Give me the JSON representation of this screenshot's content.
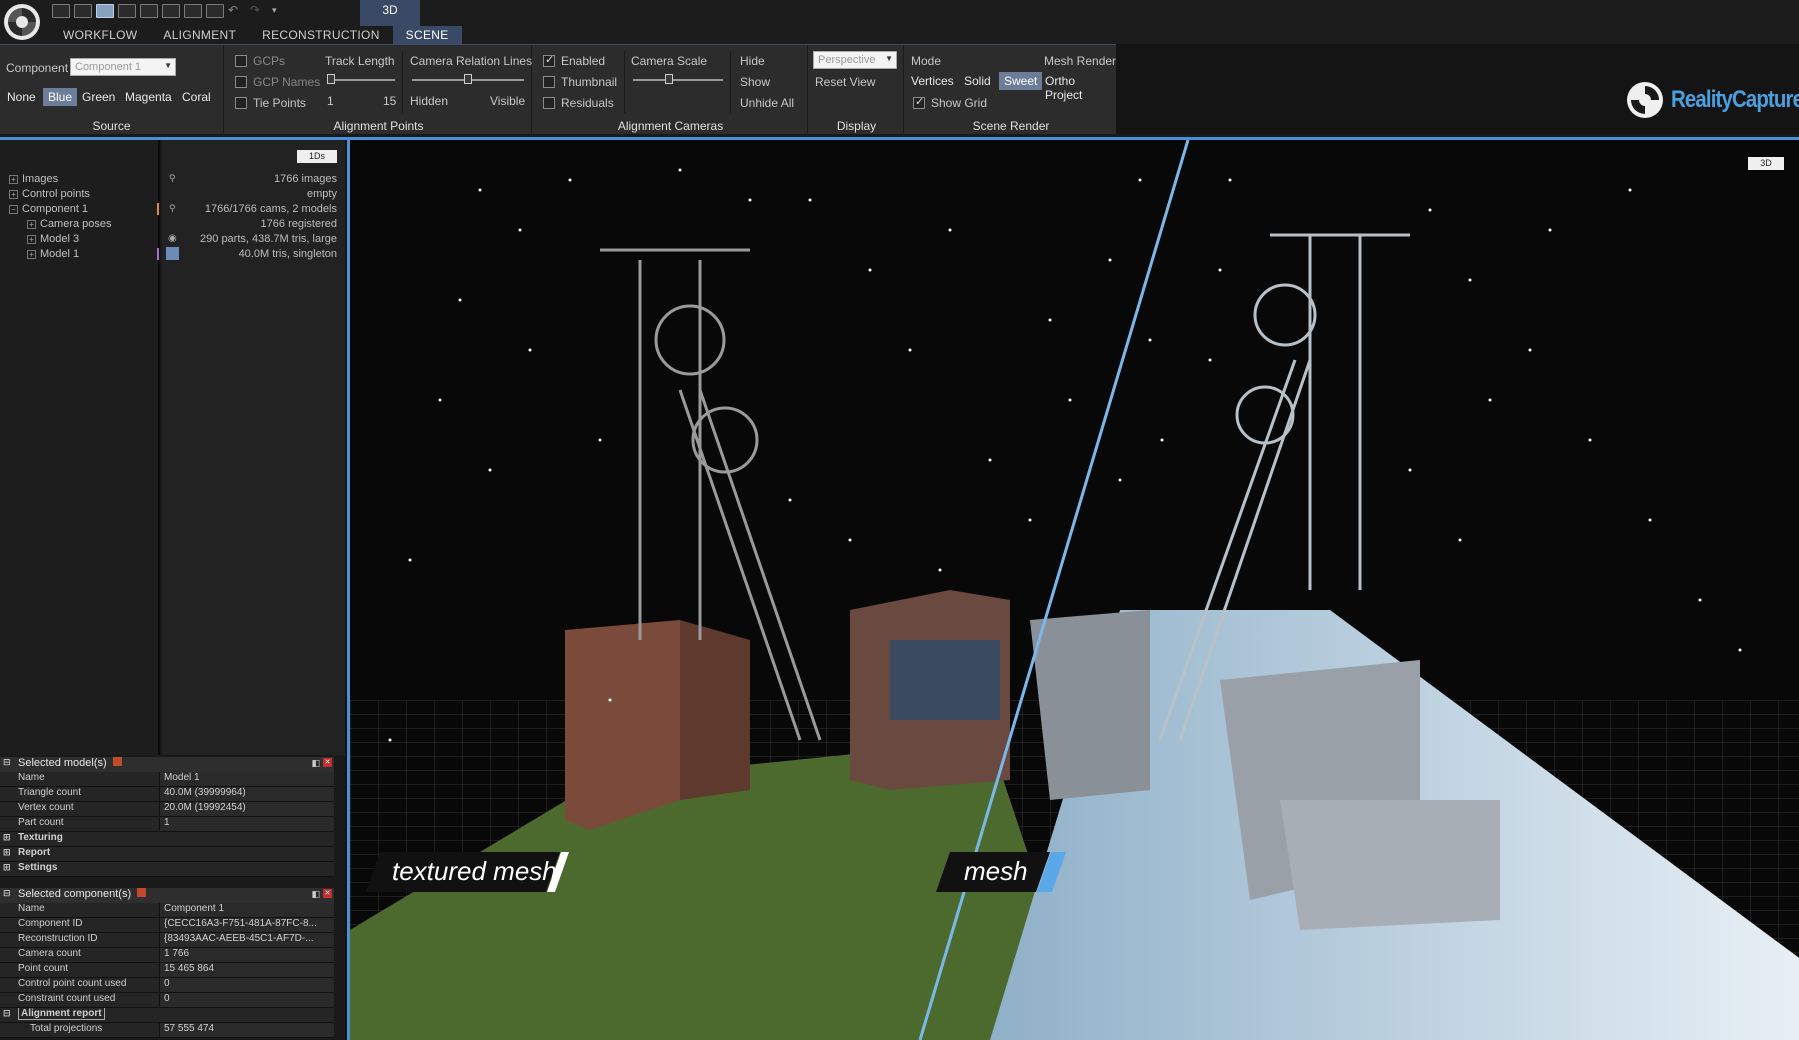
{
  "top_tabs": [
    "WORKFLOW",
    "ALIGNMENT",
    "RECONSTRUCTION",
    "SCENE"
  ],
  "active_tab": "SCENE",
  "top_3d_tab": "3D",
  "ribbon": {
    "source": {
      "title": "Source",
      "component_label": "Component",
      "component_value": "Component 1",
      "colors": [
        "None",
        "Blue",
        "Green",
        "Magenta",
        "Coral"
      ],
      "selected_color": "Blue"
    },
    "alignment_points": {
      "title": "Alignment Points",
      "gcps": "GCPs",
      "gcp_names": "GCP Names",
      "tie_points": "Tie Points",
      "track_length": "Track Length",
      "track_min": "1",
      "track_max": "15",
      "camera_relation_lines": "Camera Relation Lines",
      "hidden": "Hidden",
      "visible": "Visible"
    },
    "alignment_cameras": {
      "title": "Alignment Cameras",
      "enabled": "Enabled",
      "thumbnail": "Thumbnail",
      "residuals": "Residuals",
      "camera_scale": "Camera Scale",
      "hide": "Hide",
      "show": "Show",
      "unhide_all": "Unhide All"
    },
    "display": {
      "title": "Display",
      "projection_value": "Perspective",
      "reset_view": "Reset View"
    },
    "scene_render": {
      "title": "Scene Render",
      "mode": "Mode",
      "mesh_render": "Mesh Render",
      "vertices": "Vertices",
      "solid": "Solid",
      "sweet": "Sweet",
      "ortho_project": "Ortho Project",
      "show_grid": "Show Grid"
    }
  },
  "brand": "RealityCapture",
  "tree_button": "1Ds",
  "tree": [
    {
      "label": "Images",
      "value": "1766 images"
    },
    {
      "label": "Control points",
      "value": "empty"
    },
    {
      "label": "Component 1",
      "value": "1766/1766 cams, 2 models"
    },
    {
      "label": "Camera poses",
      "value": "1766 registered"
    },
    {
      "label": "Model 3",
      "value": "290 parts, 438.7M tris, large"
    },
    {
      "label": "Model 1",
      "value": "40.0M tris, singleton"
    }
  ],
  "selected_models": {
    "title": "Selected model(s)",
    "rows": [
      {
        "k": "Name",
        "v": "Model 1"
      },
      {
        "k": "Triangle count",
        "v": "40.0M (39999964)"
      },
      {
        "k": "Vertex count",
        "v": "20.0M (19992454)"
      },
      {
        "k": "Part count",
        "v": "1"
      }
    ],
    "sections": [
      "Texturing",
      "Report",
      "Settings"
    ]
  },
  "selected_components": {
    "title": "Selected component(s)",
    "rows": [
      {
        "k": "Name",
        "v": "Component 1"
      },
      {
        "k": "Component ID",
        "v": "{CECC16A3-F751-481A-87FC-8..."
      },
      {
        "k": "Reconstruction ID",
        "v": "{83493AAC-AEEB-45C1-AF7D-..."
      },
      {
        "k": "Camera count",
        "v": "1 766"
      },
      {
        "k": "Point count",
        "v": "15 465 864"
      },
      {
        "k": "Control point count used",
        "v": "0"
      },
      {
        "k": "Constraint count used",
        "v": "0"
      }
    ],
    "alignment_report": "Alignment report",
    "last_row": {
      "k": "Total projections",
      "v": "57 555 474"
    }
  },
  "viewport": {
    "label_left": "textured mesh",
    "label_right": "mesh",
    "badge": "3D"
  },
  "colors": {
    "accent": "#4a90d8",
    "ribbon_bg": "#2c2c2c",
    "selected": "#6c7d99"
  }
}
